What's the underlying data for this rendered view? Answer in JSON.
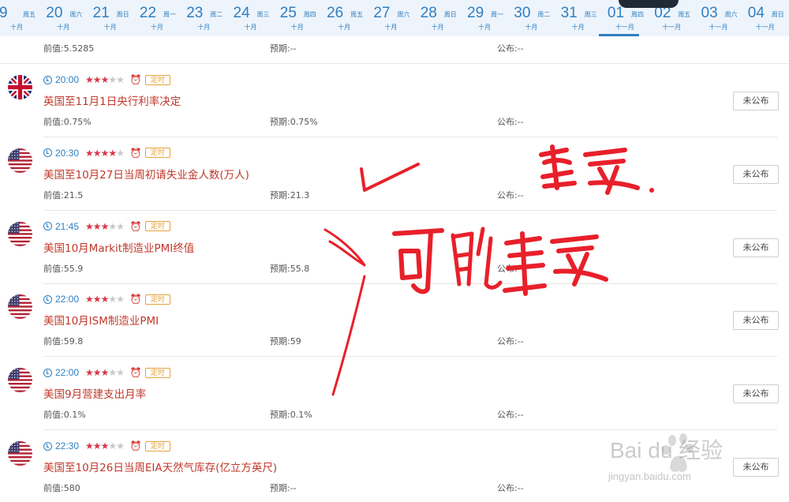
{
  "datebar": {
    "days": [
      {
        "num": "9",
        "week": "周五",
        "month": "十月"
      },
      {
        "num": "20",
        "week": "周六",
        "month": "十月"
      },
      {
        "num": "21",
        "week": "周日",
        "month": "十月"
      },
      {
        "num": "22",
        "week": "周一",
        "month": "十月"
      },
      {
        "num": "23",
        "week": "周二",
        "month": "十月"
      },
      {
        "num": "24",
        "week": "周三",
        "month": "十月"
      },
      {
        "num": "25",
        "week": "周四",
        "month": "十月"
      },
      {
        "num": "26",
        "week": "周五",
        "month": "十月"
      },
      {
        "num": "27",
        "week": "周六",
        "month": "十月"
      },
      {
        "num": "28",
        "week": "周日",
        "month": "十月"
      },
      {
        "num": "29",
        "week": "周一",
        "month": "十月"
      },
      {
        "num": "30",
        "week": "周二",
        "month": "十月"
      },
      {
        "num": "31",
        "week": "周三",
        "month": "十月"
      },
      {
        "num": "01",
        "week": "周四",
        "month": "十一月"
      },
      {
        "num": "02",
        "week": "周五",
        "month": "十一月"
      },
      {
        "num": "03",
        "week": "周六",
        "month": "十一月"
      },
      {
        "num": "04",
        "week": "周日",
        "month": "十一月"
      }
    ],
    "selected_index": 13
  },
  "partial_row": {
    "prev": "前值:5.5285",
    "forecast": "预期:--",
    "actual": "公布:--"
  },
  "events": [
    {
      "flag": "uk-flag",
      "time": "20:00",
      "stars": 3,
      "badge": "定时",
      "title": "英国至11月1日央行利率决定",
      "prev": "前值:0.75%",
      "forecast": "预期:0.75%",
      "actual": "公布:--",
      "button": "未公布"
    },
    {
      "flag": "us-flag",
      "time": "20:30",
      "stars": 4,
      "badge": "定时",
      "title": "美国至10月27日当周初请失业金人数(万人)",
      "prev": "前值:21.5",
      "forecast": "预期:21.3",
      "actual": "公布:--",
      "button": "未公布"
    },
    {
      "flag": "us-flag",
      "time": "21:45",
      "stars": 3,
      "badge": "定时",
      "title": "美国10月Markit制造业PMI终值",
      "prev": "前值:55.9",
      "forecast": "预期:55.8",
      "actual": "公布:--",
      "button": "未公布"
    },
    {
      "flag": "us-flag",
      "time": "22:00",
      "stars": 3,
      "badge": "定时",
      "title": "美国10月ISM制造业PMI",
      "prev": "前值:59.8",
      "forecast": "预期:59",
      "actual": "公布:--",
      "button": "未公布"
    },
    {
      "flag": "us-flag",
      "time": "22:00",
      "stars": 3,
      "badge": "定时",
      "title": "美国9月营建支出月率",
      "prev": "前值:0.1%",
      "forecast": "预期:0.1%",
      "actual": "公布:--",
      "button": "未公布"
    },
    {
      "flag": "us-flag",
      "time": "22:30",
      "stars": 3,
      "badge": "定时",
      "title": "美国至10月26日当周EIA天然气库存(亿立方英尺)",
      "prev": "前值:580",
      "forecast": "预期:--",
      "actual": "公布:--",
      "button": "未公布"
    }
  ],
  "watermark": {
    "brand": "Bai du 经验",
    "url": "jingyan.baidu.com"
  },
  "colors": {
    "accent": "#2e7fc1",
    "title_red": "#c0392b",
    "star_red": "#d9364a",
    "badge_orange": "#e6a23c",
    "ink_red": "#e8202a"
  }
}
